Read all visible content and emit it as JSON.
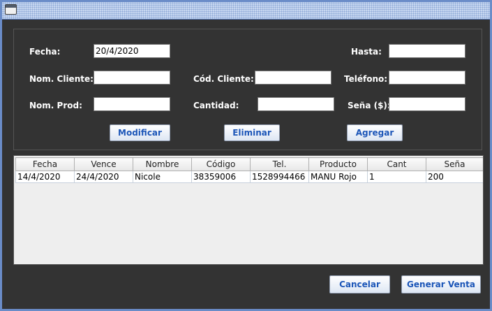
{
  "form": {
    "labels": {
      "fecha": "Fecha:",
      "hasta": "Hasta:",
      "nom_cliente": "Nom. Cliente:",
      "cod_cliente": "Cód. Cliente:",
      "telefono": "Teléfono:",
      "nom_prod": "Nom. Prod:",
      "cantidad": "Cantidad:",
      "sena": "Seña ($):"
    },
    "values": {
      "fecha": "20/4/2020",
      "hasta": "",
      "nom_cliente": "",
      "cod_cliente": "",
      "telefono": "",
      "nom_prod": "",
      "cantidad": "",
      "sena": ""
    },
    "buttons": {
      "modificar": "Modificar",
      "eliminar": "Eliminar",
      "agregar": "Agregar"
    }
  },
  "table": {
    "columns": [
      "Fecha",
      "Vence",
      "Nombre",
      "Código",
      "Tel.",
      "Producto",
      "Cant",
      "Seña"
    ],
    "rows": [
      [
        "14/4/2020",
        "24/4/2020",
        "Nicole",
        "38359006",
        "1528994466",
        "MANU Rojo",
        "1",
        "200"
      ]
    ]
  },
  "footer": {
    "cancelar": "Cancelar",
    "generar_venta": "Generar Venta"
  }
}
